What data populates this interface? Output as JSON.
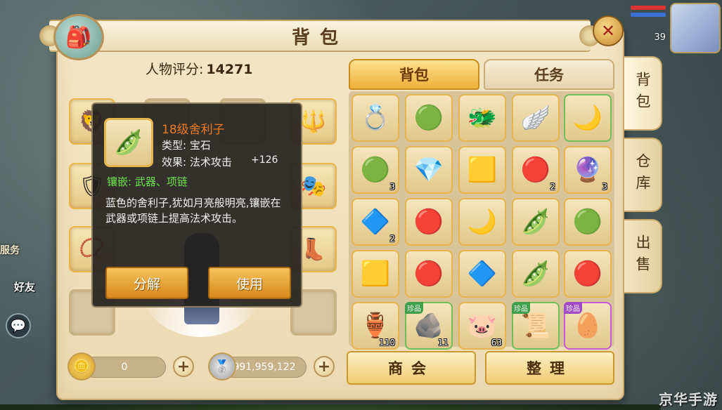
{
  "window": {
    "title": "背包"
  },
  "rating": {
    "label": "人物评分:",
    "value": "14271"
  },
  "tabs_top": [
    {
      "label": "背包",
      "active": true
    },
    {
      "label": "任务",
      "active": false
    }
  ],
  "side_tabs": [
    {
      "label": "背包"
    },
    {
      "label": "仓库"
    },
    {
      "label": "出售"
    }
  ],
  "hud": {
    "level": "39",
    "friend_label": "好友",
    "server_label": "服务"
  },
  "tooltip": {
    "name": "18级舍利子",
    "type_line": "类型: 宝石",
    "effect_line": "效果: 法术攻击",
    "effect_value": "+126",
    "inlay_line": "镶嵌: 武器、项链",
    "description": "蓝色的舍利子,犹如月亮般明亮,镶嵌在武器或项链上提高法术攻击。",
    "btn_decompose": "分解",
    "btn_use": "使用"
  },
  "currency": {
    "gold": "0",
    "silver": "991,959,122"
  },
  "bottom_buttons": {
    "shop": "商会",
    "arrange": "整理"
  },
  "inventory": [
    {
      "icon": "ring-icon",
      "glyph": "💍",
      "count": ""
    },
    {
      "icon": "jade-pendant-icon",
      "glyph": "🟢",
      "count": ""
    },
    {
      "icon": "blue-beast-icon",
      "glyph": "🐲",
      "count": ""
    },
    {
      "icon": "wings-icon",
      "glyph": "🪽",
      "count": ""
    },
    {
      "icon": "moon-gem-icon",
      "glyph": "🌙",
      "count": ""
    },
    {
      "icon": "green-orb-icon",
      "glyph": "🟢",
      "count": "3"
    },
    {
      "icon": "diamond-icon",
      "glyph": "💎",
      "count": ""
    },
    {
      "icon": "amber-gem-icon",
      "glyph": "🟨",
      "count": ""
    },
    {
      "icon": "red-swirl-icon",
      "glyph": "🔴",
      "count": "2"
    },
    {
      "icon": "purple-crystal-icon",
      "glyph": "🔮",
      "count": "3"
    },
    {
      "icon": "blue-crystal-icon",
      "glyph": "🔷",
      "count": "2"
    },
    {
      "icon": "red-swirl-icon",
      "glyph": "🔴",
      "count": ""
    },
    {
      "icon": "moon-gem-icon",
      "glyph": "🌙",
      "count": ""
    },
    {
      "icon": "green-beans-icon",
      "glyph": "🫛",
      "count": ""
    },
    {
      "icon": "green-orb-icon",
      "glyph": "🟢",
      "count": ""
    },
    {
      "icon": "amber-gem-icon",
      "glyph": "🟨",
      "count": ""
    },
    {
      "icon": "red-swirl-icon",
      "glyph": "🔴",
      "count": ""
    },
    {
      "icon": "blue-crystal-icon",
      "glyph": "🔷",
      "count": ""
    },
    {
      "icon": "green-beans-icon",
      "glyph": "🫛",
      "count": ""
    },
    {
      "icon": "red-swirl-icon",
      "glyph": "🔴",
      "count": ""
    },
    {
      "icon": "gourd-icon",
      "glyph": "🏺",
      "count": "110"
    },
    {
      "icon": "ore-icon",
      "glyph": "🪨",
      "count": "11",
      "tag": "珍品"
    },
    {
      "icon": "pig-icon",
      "glyph": "🐷",
      "count": "63"
    },
    {
      "icon": "scroll-icon",
      "glyph": "📜",
      "count": "",
      "tag": "珍品"
    },
    {
      "icon": "green-egg-icon",
      "glyph": "🥚",
      "count": "",
      "tag": "珍品"
    }
  ],
  "equipment": [
    {
      "icon": "lion-helmet-icon",
      "glyph": "🦁"
    },
    {
      "icon": "empty-slot",
      "glyph": ""
    },
    {
      "icon": "empty-slot",
      "glyph": ""
    },
    {
      "icon": "staff-icon",
      "glyph": "🔱"
    },
    {
      "icon": "purple-armor-icon",
      "glyph": "🛡"
    },
    {
      "icon": "mask-icon",
      "glyph": "🎭"
    },
    {
      "icon": "bracelet-icon",
      "glyph": "📿"
    },
    {
      "icon": "boots-icon",
      "glyph": "👢"
    }
  ]
}
